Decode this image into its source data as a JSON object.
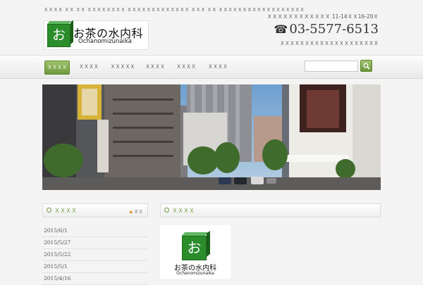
{
  "header": {
    "tagline": "ＸＸＸＸ ＸＸ ＸＸ ＸＸＸＸＸＸＸＸ ＸＸＸＸＸＸＸＸＸＸＸＸＸ ＸＸＸ ＸＸ ＸＸＸＸＸＸＸＸＸＸＸＸＸＸＸＸＸＸ",
    "logo_char": "お",
    "logo_name": "お茶の水内科",
    "logo_sub": "Ochanomizunaika",
    "hours": "ＸＸＸＸＸＸＸＸＸＸＸＸ 11-14ＸＸ16-20Ｘ",
    "phone": "03-5577-6513",
    "address": "ＸＸＸＸＸＸＸＸＸＸＸＸＸＸＸＸＸＸＸＸ"
  },
  "nav": {
    "items": [
      "ＸＸＸＸ",
      "ＸＸＸＸ",
      "ＸＸＸＸＸ",
      "ＸＸＸＸ",
      "ＸＸＸＸ",
      "ＸＸＸＸ"
    ],
    "search_placeholder": ""
  },
  "news": {
    "title": "ＸＸＸＸ",
    "rss_label": "ＸＸ",
    "items": [
      "2015/6/1",
      "2015/5/27",
      "2015/5/22",
      "2015/5/1",
      "2015/4/16"
    ]
  },
  "section2": {
    "title": "ＸＸＸＸ",
    "logo_char": "お",
    "logo_name": "お茶の水内科",
    "logo_sub": "Ochanomizunaika"
  },
  "colors": {
    "accent": "#6f9a3c",
    "logo_green": "#2a8c2a"
  }
}
